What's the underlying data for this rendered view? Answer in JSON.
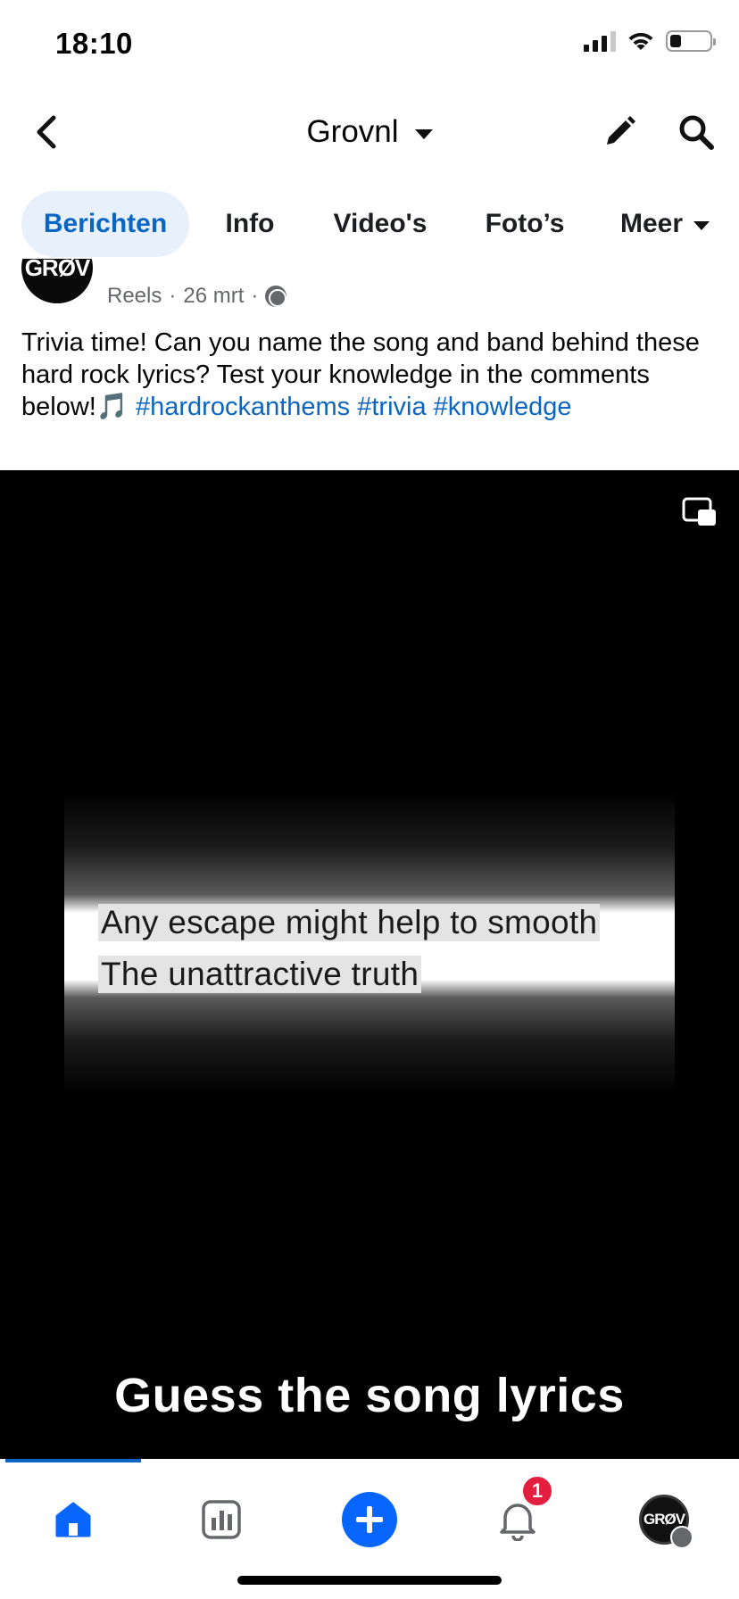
{
  "status_bar": {
    "time": "18:10"
  },
  "nav": {
    "title": "Grovnl"
  },
  "tabs": [
    {
      "label": "Berichten"
    },
    {
      "label": "Info"
    },
    {
      "label": "Video's"
    },
    {
      "label": "Foto’s"
    },
    {
      "label": "Meer"
    }
  ],
  "post": {
    "avatar_text": "GRØV",
    "category": "Reels",
    "date": "26 mrt",
    "text": "Trivia time! Can you name the song and band behind these hard rock lyrics? Test your knowledge in the comments below!🎵",
    "hashtags": [
      "#hardrockanthems",
      "#trivia",
      "#knowledge"
    ]
  },
  "video": {
    "lyric_line_1": "Any escape might help to smooth",
    "lyric_line_2": "The unattractive truth",
    "caption": "Guess the song lyrics"
  },
  "bottom_nav": {
    "notifications_badge": "1",
    "profile_avatar_text": "GRØV"
  },
  "colors": {
    "accent": "#0a66c2",
    "badge": "#e41e3f",
    "fab": "#0866ff"
  }
}
